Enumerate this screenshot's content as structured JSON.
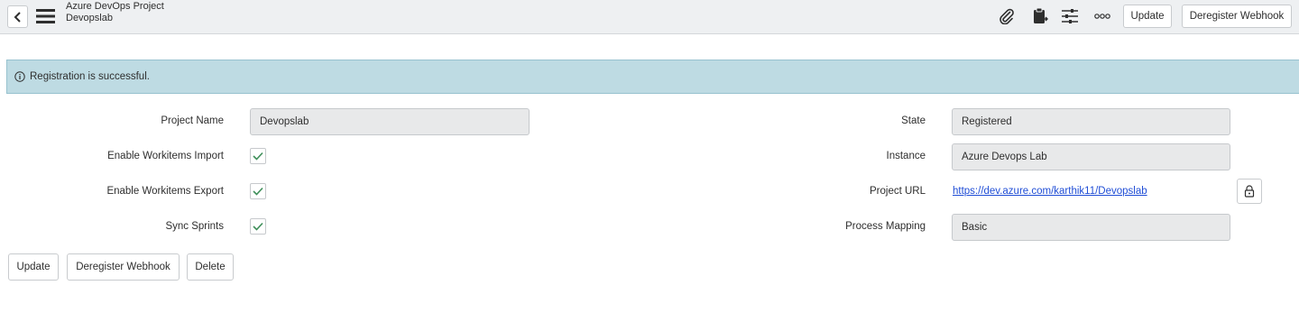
{
  "header": {
    "title": "Azure DevOps Project",
    "subtitle": "Devopslab",
    "icons": [
      "back-icon",
      "hamburger-menu-icon",
      "paperclip-icon",
      "clipboard-icon",
      "sliders-icon",
      "more-icon"
    ],
    "update_label": "Update",
    "deregister_label": "Deregister Webhook"
  },
  "alert": {
    "message": "Registration is successful.",
    "icon": "info-icon"
  },
  "form": {
    "left": {
      "project_name_label": "Project Name",
      "project_name_value": "Devopslab",
      "import_label": "Enable Workitems Import",
      "import_checked": true,
      "export_label": "Enable Workitems Export",
      "export_checked": true,
      "sync_label": "Sync Sprints",
      "sync_checked": true
    },
    "right": {
      "state_label": "State",
      "state_value": "Registered",
      "instance_label": "Instance",
      "instance_value": "Azure Devops Lab",
      "url_label": "Project URL",
      "url_value": "https://dev.azure.com/karthik11/Devopslab",
      "mapping_label": "Process Mapping",
      "mapping_value": "Basic"
    }
  },
  "footer": {
    "update_label": "Update",
    "deregister_label": "Deregister Webhook",
    "delete_label": "Delete"
  },
  "colors": {
    "header_bg": "#eef0f2",
    "alert_bg": "#bedbe3",
    "check_color": "#3f8f5a",
    "link_color": "#1f4dd6"
  }
}
